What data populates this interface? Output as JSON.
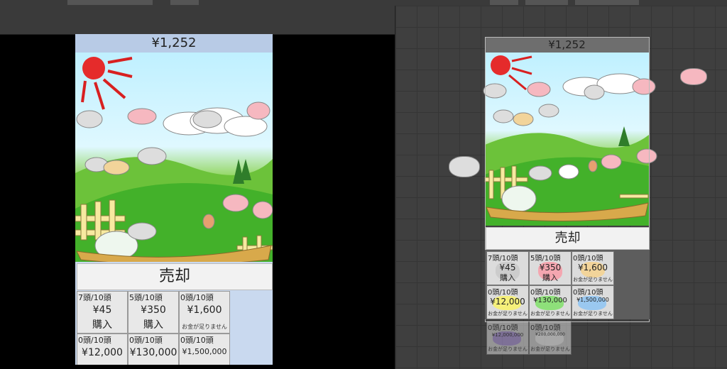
{
  "game": {
    "money": "¥1,252",
    "sell_label": "売却",
    "shop_items": [
      {
        "count": "7頭/10頭",
        "price": "¥45",
        "action": "購入",
        "color": "#cccccc"
      },
      {
        "count": "5頭/10頭",
        "price": "¥350",
        "action": "購入",
        "color": "#f4a6b0"
      },
      {
        "count": "0頭/10頭",
        "price": "¥1,600",
        "action": "お金が足りません",
        "color": "#f2d49a"
      },
      {
        "count": "0頭/10頭",
        "price": "¥12,000",
        "action": "",
        "color": "#f5f07a"
      },
      {
        "count": "0頭/10頭",
        "price": "¥130,000",
        "action": "",
        "color": "#8ee07a"
      },
      {
        "count": "0頭/10頭",
        "price": "¥1,500,000",
        "action": "",
        "color": "#9ac8f0"
      }
    ]
  },
  "scene": {
    "money": "¥1,252",
    "sell_label": "売却",
    "shop_items": [
      {
        "count": "7頭/10頭",
        "price": "¥45",
        "action": "購入",
        "color": "#cccccc"
      },
      {
        "count": "5頭/10頭",
        "price": "¥350",
        "action": "購入",
        "color": "#f4a6b0"
      },
      {
        "count": "0頭/10頭",
        "price": "¥1,600",
        "action": "お金が足りません",
        "color": "#f2d49a"
      },
      {
        "count": "0頭/10頭",
        "price": "¥12,000",
        "action": "お金が足りません",
        "color": "#f5f07a"
      },
      {
        "count": "0頭/10頭",
        "price": "¥130,000",
        "action": "お金が足りません",
        "color": "#8ee07a"
      },
      {
        "count": "0頭/10頭",
        "price": "¥1,500,000",
        "action": "お金が足りません",
        "color": "#9ac8f0"
      },
      {
        "count": "0頭/10頭",
        "price": "¥12,000,000",
        "action": "お金が足りません",
        "color": "#b29ae0"
      },
      {
        "count": "0頭/10頭",
        "price": "¥200,000,000",
        "action": "お金が足りません",
        "color": "#ffffff"
      }
    ]
  }
}
